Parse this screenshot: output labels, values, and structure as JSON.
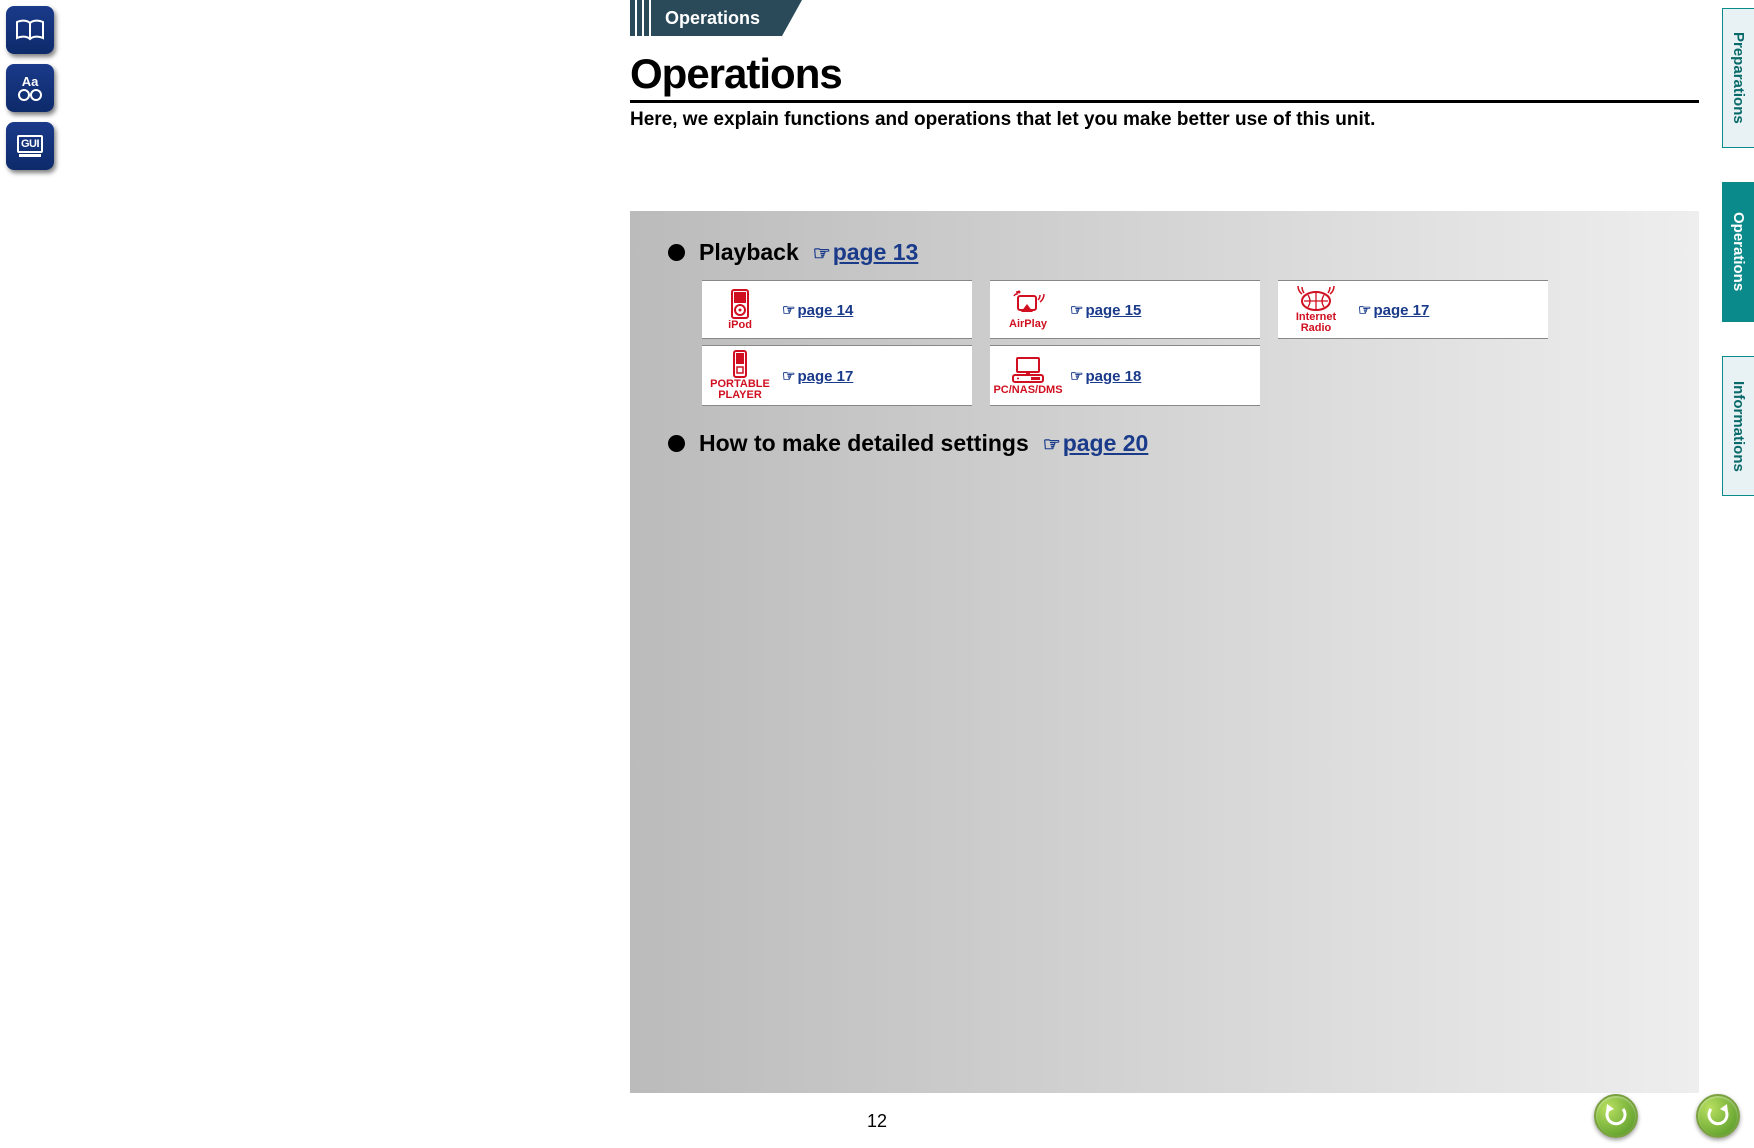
{
  "leftNav": {
    "btn1_name": "book-icon",
    "btn2_label": "Aa",
    "btn3_label": "GUI"
  },
  "rightTabs": {
    "tab1": "Preparations",
    "tab2": "Operations",
    "tab3": "Informations"
  },
  "header": {
    "tab_label": "Operations",
    "title": "Operations",
    "intro": "Here, we explain functions and operations that let you make better use of this unit."
  },
  "sections": {
    "playback_label": "Playback",
    "playback_link": "page 13",
    "settings_label": "How to make detailed settings",
    "settings_link": "page 20"
  },
  "cards": [
    {
      "icon_label": "iPod",
      "link": "page 14"
    },
    {
      "icon_label": "AirPlay",
      "link": "page 15"
    },
    {
      "icon_label": "Internet Radio",
      "link": "page 17"
    },
    {
      "icon_label": "PORTABLE PLAYER",
      "link": "page 17"
    },
    {
      "icon_label": "PC/NAS/DMS",
      "link": "page 18"
    }
  ],
  "page_number": "12",
  "hand_glyph": "☞"
}
